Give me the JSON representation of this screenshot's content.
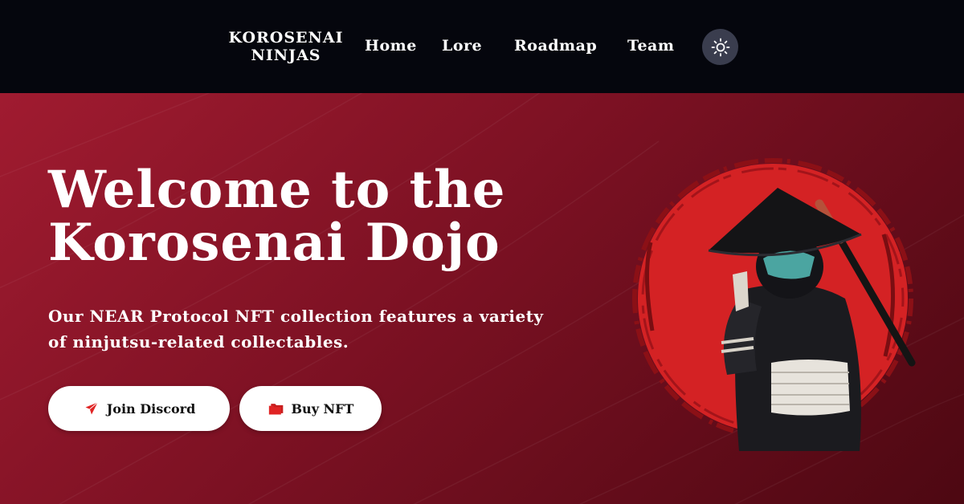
{
  "header": {
    "brand": "KOROSENAI NINJAS",
    "nav": [
      "Home",
      "Lore",
      "Roadmap",
      "Team"
    ],
    "theme_toggle_icon": "sun-icon"
  },
  "hero": {
    "title": "Welcome to the Korosenai Dojo",
    "subtitle": "Our NEAR Protocol NFT collection features a variety of ninjutsu-related collectables.",
    "buttons": [
      {
        "label": "Join Discord",
        "icon": "paper-plane-icon"
      },
      {
        "label": "Buy NFT",
        "icon": "folder-icon"
      }
    ],
    "image": "ninja-character-on-red-ink-circle"
  },
  "colors": {
    "nav_bg": "#05060d",
    "hero_red": "#a01b30",
    "accent_red": "#e02424",
    "button_bg": "#ffffff"
  }
}
